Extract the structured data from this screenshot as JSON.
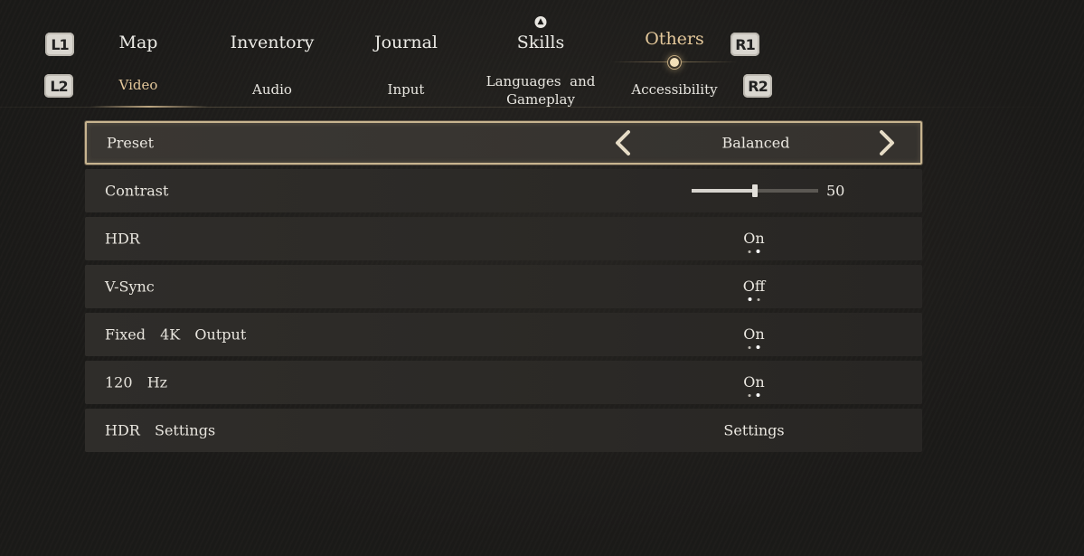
{
  "controller_buttons": {
    "l1": "L1",
    "l2": "L2",
    "r1": "R1",
    "r2": "R2"
  },
  "top_tabs": [
    {
      "label": "Map",
      "active": false
    },
    {
      "label": "Inventory",
      "active": false
    },
    {
      "label": "Journal",
      "active": false
    },
    {
      "label": "Skills",
      "active": false,
      "icon": "skill-point-icon"
    },
    {
      "label": "Others",
      "active": true
    }
  ],
  "sub_tabs": [
    {
      "label": "Video",
      "active": true
    },
    {
      "label": "Audio",
      "active": false
    },
    {
      "label": "Input",
      "active": false
    },
    {
      "label_line1": "Languages  and",
      "label_line2": "Gameplay",
      "active": false
    },
    {
      "label": "Accessibility",
      "active": false
    }
  ],
  "settings": [
    {
      "label": "Preset",
      "value": "Balanced",
      "type": "selector",
      "selected": true
    },
    {
      "label": "Contrast",
      "value": "50",
      "type": "slider",
      "level": 0.5
    },
    {
      "label": "HDR",
      "value": "On",
      "type": "toggle",
      "option_index": 1,
      "option_count": 2
    },
    {
      "label": "V-Sync",
      "value": "Off",
      "type": "toggle",
      "option_index": 0,
      "option_count": 2
    },
    {
      "label": "Fixed  4K  Output",
      "value": "On",
      "type": "toggle",
      "option_index": 1,
      "option_count": 2
    },
    {
      "label": "120  Hz",
      "value": "On",
      "type": "toggle",
      "option_index": 1,
      "option_count": 2
    },
    {
      "label": "HDR  Settings",
      "value": "Settings",
      "type": "button"
    }
  ],
  "colors": {
    "accent": "#e3c79a",
    "selection_border": "#c7b48f",
    "background": "#1b1a18"
  }
}
